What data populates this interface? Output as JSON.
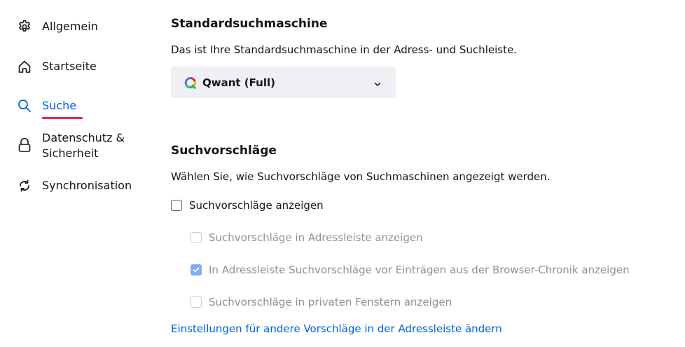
{
  "sidebar": {
    "items": [
      {
        "label": "Allgemein",
        "icon": "gear-icon"
      },
      {
        "label": "Startseite",
        "icon": "home-icon"
      },
      {
        "label": "Suche",
        "icon": "search-icon",
        "active": true
      },
      {
        "label": "Datenschutz & Sicherheit",
        "icon": "lock-icon"
      },
      {
        "label": "Synchronisation",
        "icon": "sync-icon"
      }
    ]
  },
  "default_engine": {
    "title": "Standardsuchmaschine",
    "description": "Das ist Ihre Standardsuchmaschine in der Adress- und Suchleiste.",
    "selected": "Qwant (Full)"
  },
  "suggestions": {
    "title": "Suchvorschläge",
    "description": "Wählen Sie, wie Suchvorschläge von Suchmaschinen angezeigt werden.",
    "show_suggestions": {
      "label": "Suchvorschläge anzeigen",
      "checked": false
    },
    "options": [
      {
        "label": "Suchvorschläge in Adressleiste anzeigen",
        "checked": false,
        "disabled": true
      },
      {
        "label": "In Adressleiste Suchvorschläge vor Einträgen aus der Browser-Chronik anzeigen",
        "checked": true,
        "disabled": true
      },
      {
        "label": "Suchvorschläge in privaten Fenstern anzeigen",
        "checked": false,
        "disabled": true
      }
    ],
    "link": "Einstellungen für andere Vorschläge in der Adressleiste ändern"
  },
  "colors": {
    "accent": "#0061e0",
    "active_underline": "#e22850",
    "select_bg": "#f0f0f4",
    "checked_disabled": "#80aef0"
  }
}
